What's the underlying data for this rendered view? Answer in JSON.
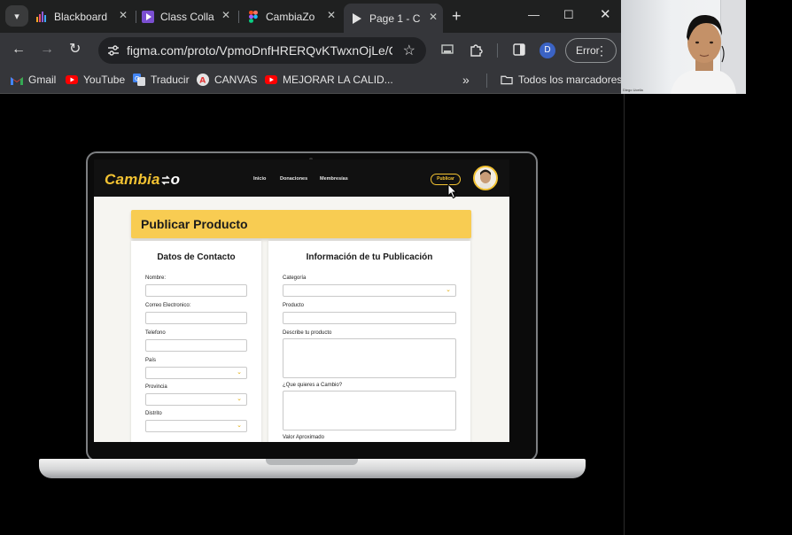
{
  "browser": {
    "tabs": [
      {
        "label": "Blackboard",
        "icon": "blackboard-icon"
      },
      {
        "label": "Class Colla",
        "icon": "class-collab-icon"
      },
      {
        "label": "CambiaZo",
        "icon": "figma-icon"
      },
      {
        "label": "Page 1 - C",
        "icon": "play-icon",
        "active": true
      }
    ],
    "url": "figma.com/proto/VpmoDnfHRERQvKTwxnOjLe/Cam...",
    "profile_initial": "D",
    "error_label": "Error",
    "bookmarks": [
      {
        "label": "Gmail",
        "icon": "gmail-icon"
      },
      {
        "label": "YouTube",
        "icon": "youtube-icon"
      },
      {
        "label": "Traducir",
        "icon": "translate-icon"
      },
      {
        "label": "CANVAS",
        "icon": "canvas-icon"
      },
      {
        "label": "MEJORAR LA CALID...",
        "icon": "youtube-icon"
      }
    ],
    "all_bookmarks": "Todos los marcadores"
  },
  "webcam": {
    "participant_name": "Diego Ucella"
  },
  "app": {
    "logo_main": "Cambia",
    "logo_suffix": "o",
    "nav": [
      "Inicio",
      "Donaciones",
      "Membresías"
    ],
    "publish_button": "Publicar",
    "page_title": "Publicar Producto",
    "contact": {
      "title": "Datos de Contacto",
      "fields": [
        "Nombre:",
        "Correo Electronico:",
        "Telefono",
        "País",
        "Provincia",
        "Distrito"
      ]
    },
    "publication": {
      "title": "Información de tu Publicación",
      "fields": [
        "Categoría",
        "Producto",
        "Describe tu producto",
        "¿Que quieres a Cambio?",
        "Valor Aproximado"
      ]
    }
  },
  "colors": {
    "accent": "#f2c232",
    "banner": "#f8cc52",
    "app_nav": "#111111"
  }
}
